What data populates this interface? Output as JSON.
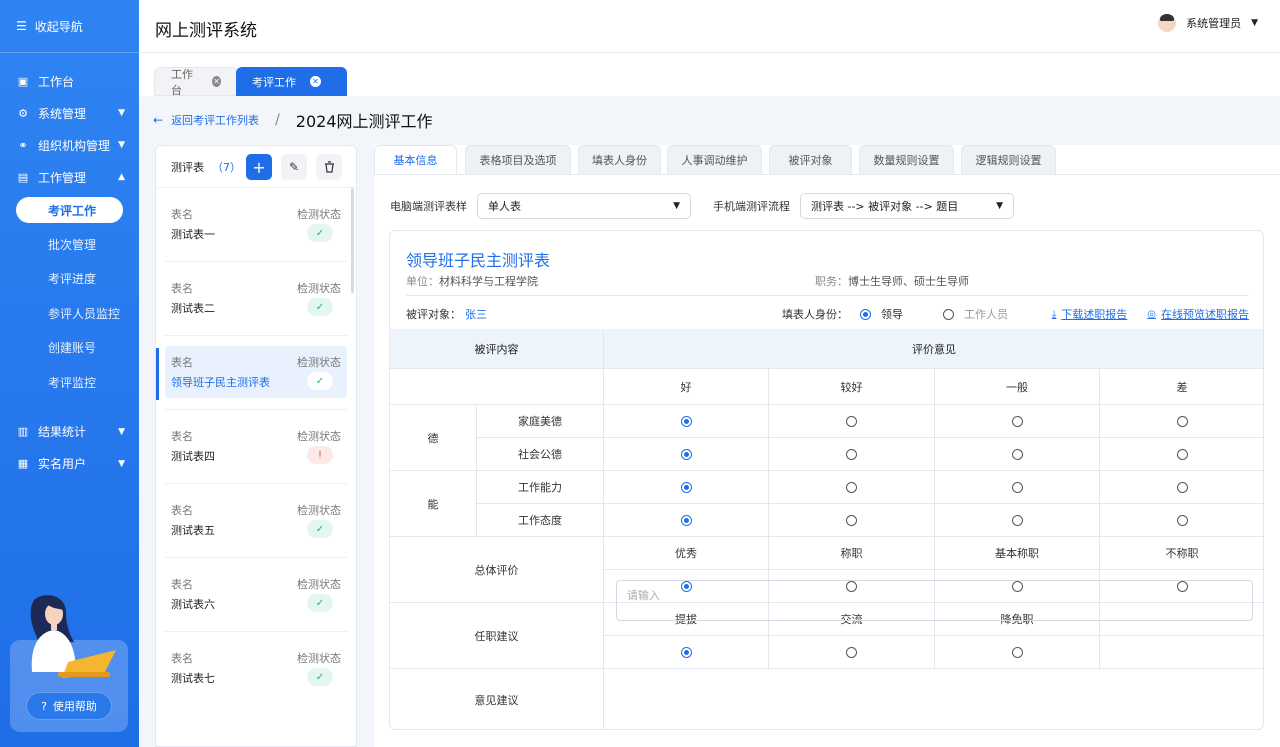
{
  "sidebar": {
    "collapse_label": "收起导航",
    "items": [
      {
        "label": "工作台",
        "icon": "monitor-icon"
      },
      {
        "label": "系统管理",
        "icon": "gear-icon"
      },
      {
        "label": "组织机构管理",
        "icon": "org-icon"
      },
      {
        "label": "工作管理",
        "icon": "briefcase-icon"
      }
    ],
    "sub_items": [
      {
        "label": "考评工作",
        "active": true
      },
      {
        "label": "批次管理"
      },
      {
        "label": "考评进度"
      },
      {
        "label": "参评人员监控"
      },
      {
        "label": "创建账号"
      },
      {
        "label": "考评监控"
      }
    ],
    "items2": [
      {
        "label": "结果统计",
        "icon": "chart-icon"
      },
      {
        "label": "实名用户",
        "icon": "id-card-icon"
      }
    ],
    "help_label": "使用帮助"
  },
  "header": {
    "app_title": "网上测评系统",
    "user_name": "系统管理员"
  },
  "tabs": [
    {
      "label": "工作台"
    },
    {
      "label": "考评工作"
    }
  ],
  "breadcrumb": {
    "back_label": "返回考评工作列表",
    "separator": "/",
    "title": "2024网上测评工作"
  },
  "list_panel": {
    "label": "测评表",
    "count": "（7）",
    "key_label": "表名",
    "status_label": "检测状态",
    "items": [
      {
        "name": "测试表一",
        "status": "ok",
        "glyph": "✓"
      },
      {
        "name": "测试表二",
        "status": "ok",
        "glyph": "✓"
      },
      {
        "name": "领导班子民主测评表",
        "status": "ok",
        "glyph": "✓",
        "active": true
      },
      {
        "name": "测试表四",
        "status": "warn",
        "glyph": "!"
      },
      {
        "name": "测试表五",
        "status": "ok",
        "glyph": "✓"
      },
      {
        "name": "测试表六",
        "status": "ok",
        "glyph": "✓"
      },
      {
        "name": "测试表七",
        "status": "ok",
        "glyph": "✓"
      }
    ]
  },
  "main_tabs": [
    {
      "label": "基本信息",
      "active": true
    },
    {
      "label": "表格项目及选项"
    },
    {
      "label": "填表人身份"
    },
    {
      "label": "人事调动维护"
    },
    {
      "label": "被评对象"
    },
    {
      "label": "数量规则设置"
    },
    {
      "label": "逻辑规则设置"
    }
  ],
  "form": {
    "pc_style_label": "电脑端测评表样",
    "pc_style_value": "单人表",
    "mobile_flow_label": "手机端测评流程",
    "mobile_flow_value": "测评表 --> 被评对象 --> 题目"
  },
  "card": {
    "title": "领导班子民主测评表",
    "unit_label": "单位：",
    "unit_value": "材料科学与工程学院",
    "duty_label": "职务：",
    "duty_value": "博士生导师、硕士生导师",
    "target_label": "被评对象：",
    "target_value": "张三",
    "role_label": "填表人身份：",
    "roles": [
      {
        "label": "领导",
        "checked": true
      },
      {
        "label": "工作人员",
        "checked": false
      }
    ],
    "download_label": "下载述职报告",
    "preview_label": "在线预览述职报告"
  },
  "table": {
    "col_content": "被评内容",
    "col_opinion": "评价意见",
    "grades": [
      "好",
      "较好",
      "一般",
      "差"
    ],
    "groups": [
      {
        "name": "德",
        "rows": [
          {
            "label": "家庭美德",
            "selected": 0
          },
          {
            "label": "社会公德",
            "selected": 0
          }
        ]
      },
      {
        "name": "能",
        "rows": [
          {
            "label": "工作能力",
            "selected": 0
          },
          {
            "label": "工作态度",
            "selected": 0
          }
        ]
      }
    ],
    "overall_label": "总体评价",
    "overall_options": [
      "优秀",
      "称职",
      "基本称职",
      "不称职"
    ],
    "overall_selected": 0,
    "post_label": "任职建议",
    "post_options": [
      "提拔",
      "交流",
      "降免职"
    ],
    "post_selected": 0,
    "suggestion_label": "意见建议",
    "suggestion_placeholder": "请输入"
  },
  "colors": {
    "primary": "#1f6ee8",
    "sidebar": "#2f84f2",
    "success": "#21b07a",
    "danger": "#e04a4a"
  }
}
